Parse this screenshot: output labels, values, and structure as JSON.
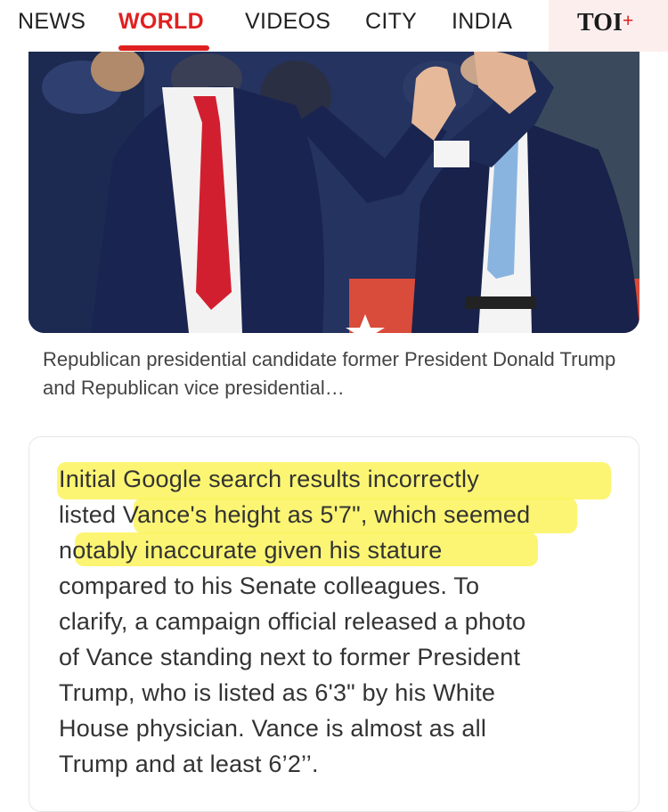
{
  "nav": {
    "items": [
      "NEWS",
      "WORLD",
      "VIDEOS",
      "CITY",
      "INDIA"
    ],
    "active": "WORLD",
    "brand": "TOI",
    "brand_plus": "+"
  },
  "photo": {
    "caption": "Republican presidential candidate former President Donald Trump and Republican vice presidential…"
  },
  "article": {
    "lines": [
      "Initial Google search results incorrectly",
      "listed Vance's height as 5'7\", which seemed",
      "notably inaccurate given his stature",
      "compared to his Senate colleagues. To",
      "clarify, a campaign official released a photo",
      "of Vance standing next to former President",
      "Trump, who is listed as 6'3\" by his White",
      "House physician. Vance is almost as all",
      "Trump and at least 6’2’’."
    ],
    "highlight_color": "#fbf35a"
  },
  "colors": {
    "accent": "#e02020",
    "brand_bg": "#fdeeee"
  }
}
